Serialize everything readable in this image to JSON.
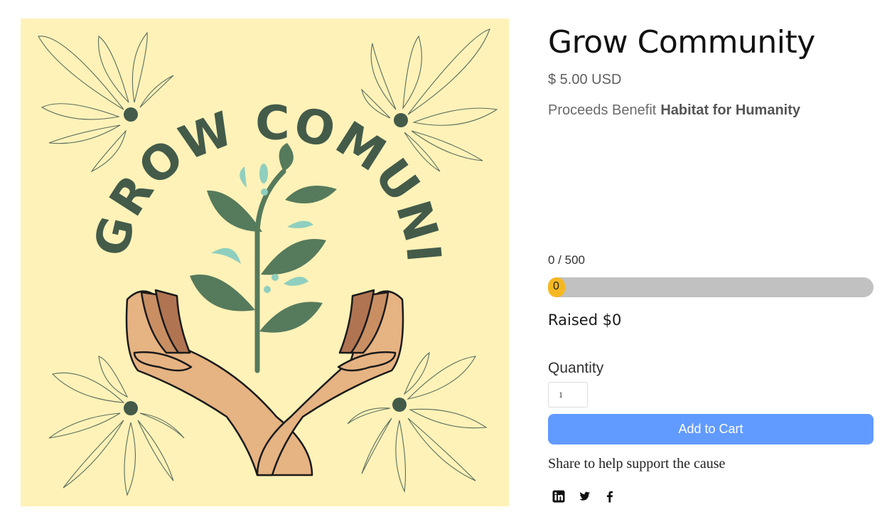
{
  "product": {
    "title": "Grow Community",
    "price": "$ 5.00 USD",
    "benefit_prefix": "Proceeds Benefit",
    "benefit_org": "Habitat for Humanity",
    "image": {
      "lettering": "GROW COMUNITY",
      "background": "#fff2b8",
      "accent": "#445b4a",
      "leaf_color": "#567a5c",
      "drop_color": "#8fcfbf"
    }
  },
  "fundraiser": {
    "goal_text": "0 / 500",
    "progress_label": "0",
    "progress_fraction": 0,
    "raised_text": "Raised $0",
    "bar_fill_color": "#f5b820",
    "bar_track_color": "#c1c1c1"
  },
  "quantity": {
    "label": "Quantity",
    "value": "1"
  },
  "cart": {
    "button_label": "Add to Cart",
    "button_color": "#629bff"
  },
  "share": {
    "text": "Share to help support the cause",
    "icons": [
      "linkedin-icon",
      "twitter-icon",
      "facebook-icon"
    ]
  }
}
